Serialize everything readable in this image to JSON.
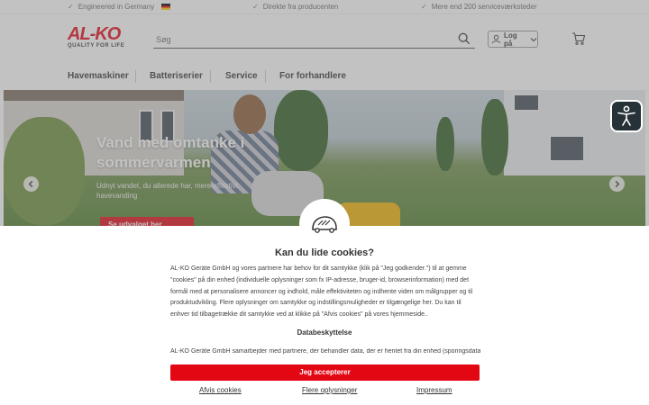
{
  "topbar": {
    "usp1": "Engineered in Germany",
    "usp2": "Direkte fra producenten",
    "usp3": "Mere end 200 serviceværksteder"
  },
  "header": {
    "logo_text": "AL-KO",
    "logo_tagline": "QUALITY FOR LIFE",
    "search_placeholder": "Søg",
    "login_label": "Log på"
  },
  "nav": {
    "items": [
      "Havemaskiner",
      "Batteriserier",
      "Service",
      "For forhandlere"
    ]
  },
  "hero": {
    "title_line1": "Vand med omtanke i",
    "title_line2": "sommervarmen",
    "subtitle": "Udnyt vandet, du allerede har, mere effektivt havevanding",
    "button_label": "Se udvalget her"
  },
  "cookie": {
    "title": "Kan du lide cookies?",
    "body": "AL-KO Geräte GmbH og vores partnere har behov for dit samtykke (klik på \"Jeg godkender.\") til at gemme \"cookies\" på din enhed (individuelle oplysninger som fx IP-adresse, bruger-id, browserinformation) med det formål med at personalisere annoncer og indhold, måle effektiviteten og indhente viden om målgrupper og til produktudvikling. Flere oplysninger om samtykke og indstillingsmuligheder er tilgængelige her. Du kan til enhver tid tilbagetrække dit samtykke ved at klikke på \"Afvis cookies\" på vores hjemmeside..",
    "section_heading": "Databeskyttelse",
    "section_body": "AL-KO Geräte GmbH samarbejder med partnere, der behandler data, der er hentet fra din enhed (sporingsdata) til",
    "accept_label": "Jeg accepterer",
    "reject_label": "Afvis cookies",
    "more_label": "Flere oplysninger",
    "imprint_label": "Impressum"
  },
  "colors": {
    "brand_red": "#e30613",
    "overlay": "rgba(120,120,120,.45)",
    "accessibility_button": "#263238"
  },
  "icons": [
    "check-icon",
    "german-flag-icon",
    "search-icon",
    "user-icon",
    "chevron-down-icon",
    "cart-icon",
    "arrow-left-icon",
    "arrow-right-icon",
    "accessibility-icon",
    "robot-mower-icon"
  ]
}
